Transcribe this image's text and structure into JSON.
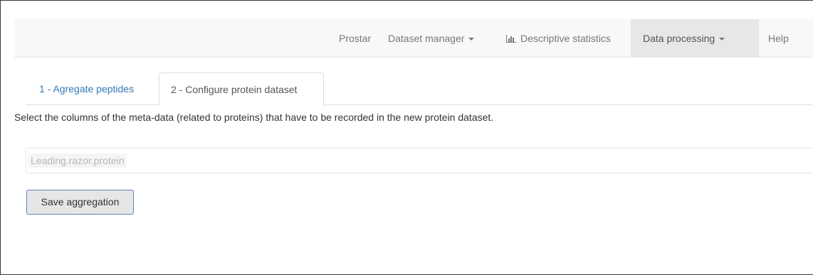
{
  "navbar": {
    "items": [
      {
        "label": "Prostar"
      },
      {
        "label": "Dataset manager",
        "icon": "caret-down-icon"
      },
      {
        "label": "Descriptive statistics",
        "icon": "bar-chart-icon"
      },
      {
        "label": "Data processing",
        "icon": "caret-down-icon",
        "active": true
      },
      {
        "label": "Help"
      }
    ]
  },
  "tabs": [
    {
      "label": "1 - Agregate peptides",
      "active": false
    },
    {
      "label": "2 - Configure protein dataset",
      "active": true
    }
  ],
  "main": {
    "description": "Select the columns of the meta-data (related to proteins) that have to be recorded in the new protein dataset.",
    "selected_columns": [
      "Leading.razor.protein"
    ],
    "save_button_label": "Save aggregation"
  },
  "colors": {
    "navbar_bg": "#f8f8f8",
    "active_nav_bg": "#e7e7e7",
    "link": "#337ab7",
    "button_border": "#5b86b9"
  }
}
